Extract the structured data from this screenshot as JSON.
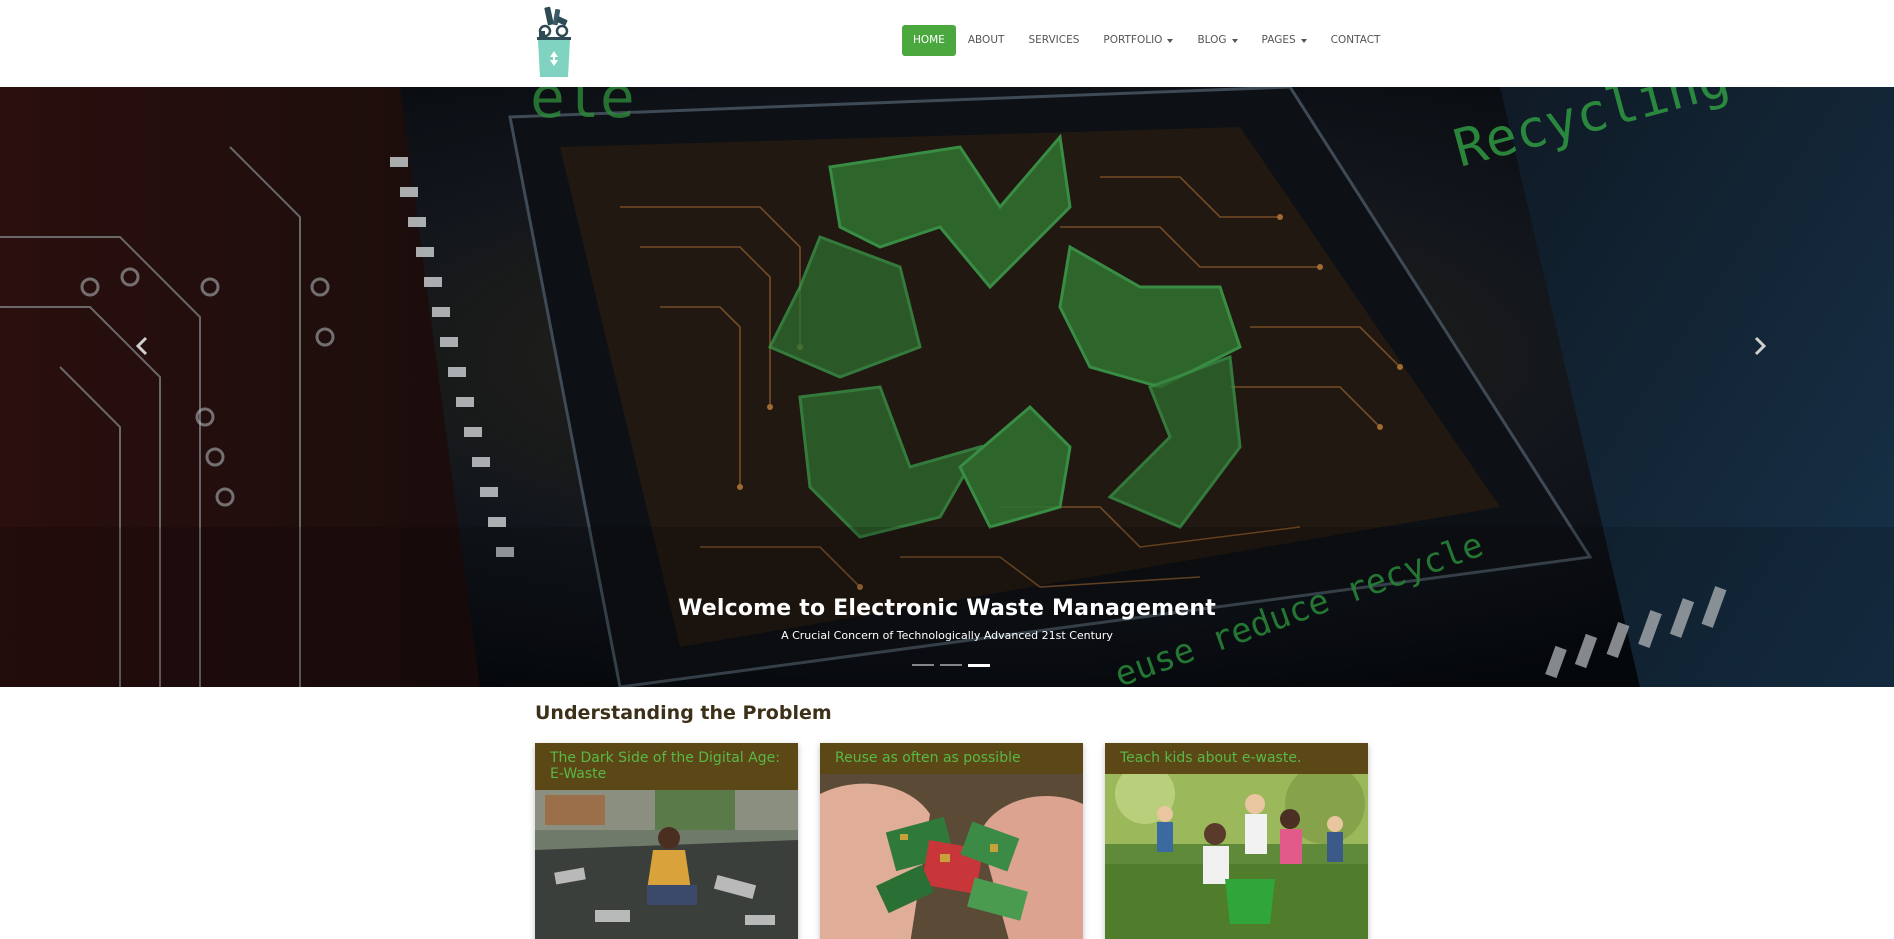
{
  "nav": {
    "items": [
      {
        "label": "HOME",
        "active": true,
        "dropdown": false
      },
      {
        "label": "ABOUT",
        "active": false,
        "dropdown": false
      },
      {
        "label": "SERVICES",
        "active": false,
        "dropdown": false
      },
      {
        "label": "PORTFOLIO",
        "active": false,
        "dropdown": true
      },
      {
        "label": "BLOG",
        "active": false,
        "dropdown": true
      },
      {
        "label": "PAGES",
        "active": false,
        "dropdown": true
      },
      {
        "label": "CONTACT",
        "active": false,
        "dropdown": false
      }
    ]
  },
  "hero": {
    "title": "Welcome to Electronic Waste Management",
    "subtitle": "A Crucial Concern of Technologically Advanced 21st Century",
    "slide_count": 3,
    "active_slide": 3,
    "image_text": {
      "top_left": "ele",
      "top_right": "Recycling",
      "bottom": "euse reduce recycle"
    }
  },
  "section": {
    "title": "Understanding the Problem",
    "cards": [
      {
        "title": "The Dark Side of the Digital Age: E-Waste"
      },
      {
        "title": "Reuse as often as possible"
      },
      {
        "title": "Teach kids about e-waste."
      }
    ]
  },
  "colors": {
    "accent": "#4aa83f",
    "card_header_bg": "#5c4716",
    "card_header_text": "#58b947",
    "heading": "#3d3019"
  }
}
